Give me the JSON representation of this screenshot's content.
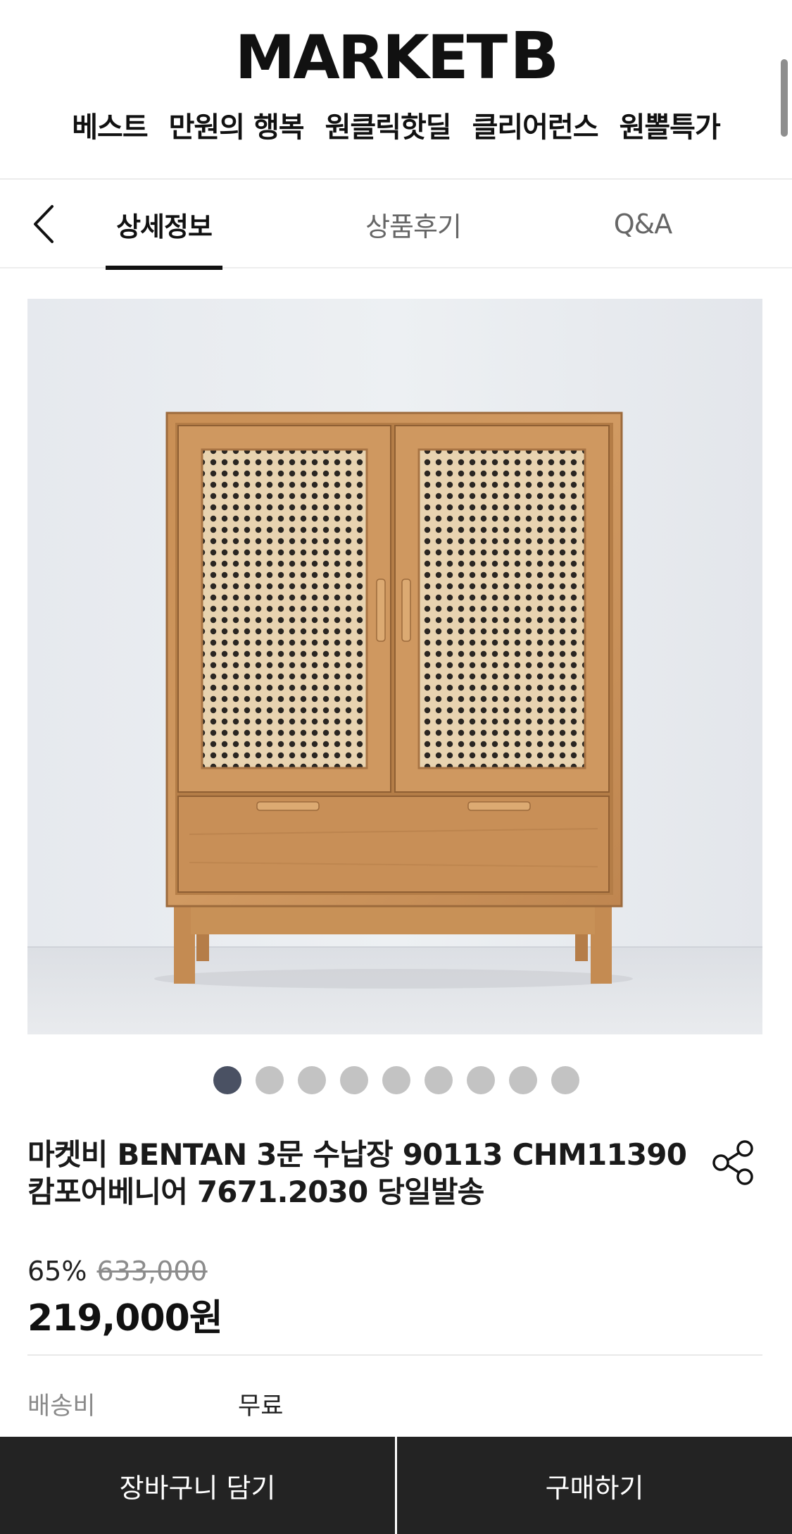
{
  "header": {
    "logo_main": "MARKET",
    "logo_letter": "B",
    "nav": [
      "베스트",
      "만원의 행복",
      "원클릭핫딜",
      "클리어런스",
      "원뽈특가"
    ]
  },
  "tabs": {
    "back_icon": "chevron-left-icon",
    "items": [
      "상세정보",
      "상품후기",
      "Q&A"
    ],
    "active_index": 0
  },
  "gallery": {
    "image_count": 9,
    "active_index": 0,
    "dot_active_color": "#4a5163",
    "dot_color": "#c3c3c3"
  },
  "product": {
    "title_line1": "마켓비 BENTAN 3문 수납장 90113 CHM11390",
    "title_line2": "캄포어베니어 7671.2030 당일발송",
    "share_icon": "share-icon",
    "discount_rate": "65%",
    "original_price": "633,000",
    "price": "219,000원",
    "shipping_label": "배송비",
    "shipping_value": "무료"
  },
  "bottom_bar": {
    "cart_label": "장바구니 담기",
    "buy_label": "구매하기",
    "background": "#232323"
  }
}
